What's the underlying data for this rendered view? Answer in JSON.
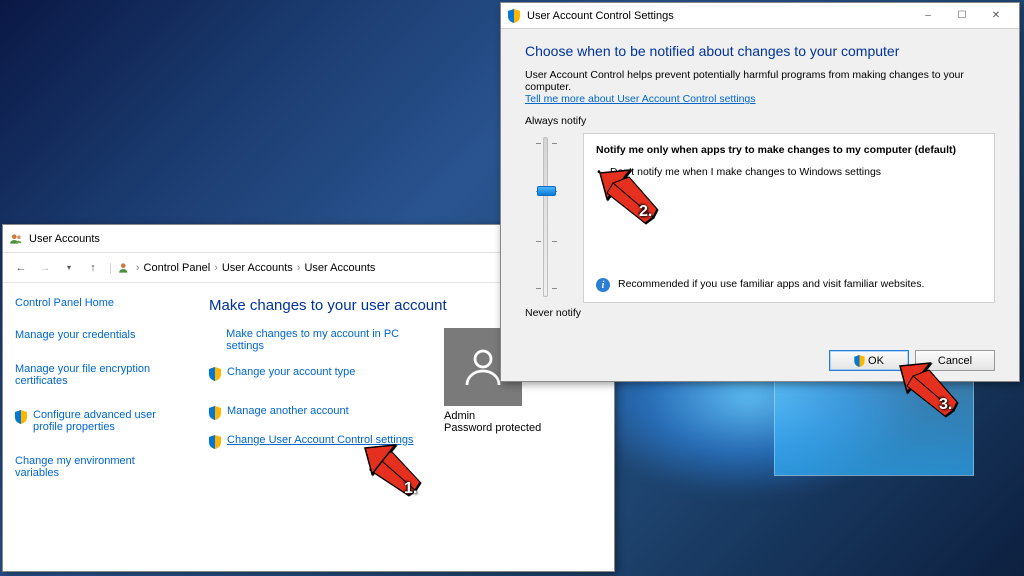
{
  "control_panel": {
    "title": "User Accounts",
    "breadcrumbs": [
      "Control Panel",
      "User Accounts",
      "User Accounts"
    ],
    "sidebar": {
      "home": "Control Panel Home",
      "items": [
        {
          "label": "Manage your credentials",
          "shield": false
        },
        {
          "label": "Manage your file encryption certificates",
          "shield": false
        },
        {
          "label": "Configure advanced user profile properties",
          "shield": true
        },
        {
          "label": "Change my environment variables",
          "shield": false
        }
      ]
    },
    "main": {
      "heading": "Make changes to your user account",
      "items": [
        {
          "label": "Make changes to my account in PC settings",
          "shield": false,
          "underline": false
        },
        {
          "label": "Change your account type",
          "shield": true,
          "underline": false
        },
        {
          "label": "Manage another account",
          "shield": true,
          "underline": false
        },
        {
          "label": "Change User Account Control settings",
          "shield": true,
          "underline": true
        }
      ],
      "account": {
        "name": "Admin",
        "protected": "Password protected"
      }
    }
  },
  "uac": {
    "title": "User Account Control Settings",
    "heading": "Choose when to be notified about changes to your computer",
    "description": "User Account Control helps prevent potentially harmful programs from making changes to your computer.",
    "learn_more": "Tell me more about User Account Control settings",
    "always_notify": "Always notify",
    "never_notify": "Never notify",
    "slider": {
      "levels": 4,
      "current_index": 1
    },
    "info": {
      "title": "Notify me only when apps try to make changes to my computer (default)",
      "bullet": "Don't notify me when I make changes to Windows settings",
      "recommendation": "Recommended if you use familiar apps and visit familiar websites."
    },
    "buttons": {
      "ok": "OK",
      "cancel": "Cancel"
    }
  },
  "annotations": {
    "a1": "1.",
    "a2": "2.",
    "a3": "3."
  }
}
